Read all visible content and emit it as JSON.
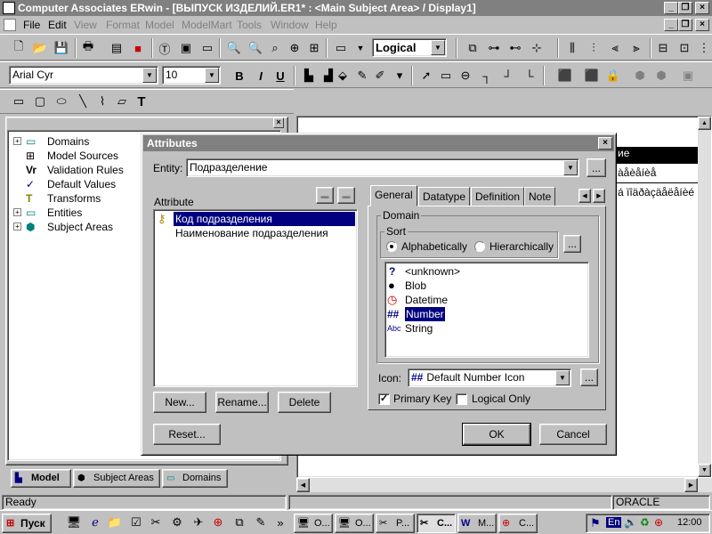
{
  "window": {
    "title": "Computer Associates ERwin - [ВЫПУСК ИЗДЕЛИЙ.ER1* : <Main Subject Area> / Display1]"
  },
  "menu": [
    {
      "label": "File",
      "enabled": true
    },
    {
      "label": "Edit",
      "enabled": true
    },
    {
      "label": "View",
      "enabled": false
    },
    {
      "label": "Format",
      "enabled": false
    },
    {
      "label": "Model",
      "enabled": false
    },
    {
      "label": "ModelMart",
      "enabled": false
    },
    {
      "label": "Tools",
      "enabled": false
    },
    {
      "label": "Window",
      "enabled": false
    },
    {
      "label": "Help",
      "enabled": false
    }
  ],
  "toolbar": {
    "view_level": "Logical",
    "font_name": "Arial Cyr",
    "font_size": "10",
    "bold": "B",
    "italic": "I",
    "underline": "U",
    "text_tool": "T"
  },
  "tree": {
    "items": [
      {
        "label": "Domains",
        "expandable": true,
        "icon": "domains-icon"
      },
      {
        "label": "Model Sources",
        "expandable": false,
        "icon": "model-sources-icon"
      },
      {
        "label": "Validation Rules",
        "expandable": false,
        "icon": "validation-rules-icon"
      },
      {
        "label": "Default Values",
        "expandable": false,
        "icon": "default-values-icon"
      },
      {
        "label": "Transforms",
        "expandable": false,
        "icon": "transforms-icon"
      },
      {
        "label": "Entities",
        "expandable": true,
        "icon": "entities-icon"
      },
      {
        "label": "Subject Areas",
        "expandable": true,
        "icon": "subject-areas-icon"
      }
    ],
    "tabs": [
      "Model",
      "Subject Areas",
      "Domains"
    ]
  },
  "canvas": {
    "snippet_1": "ие",
    "snippet_2": "àåèåíèå",
    "snippet_3": "á ïîäðàçäåëåíèé"
  },
  "dialog": {
    "title": "Attributes",
    "entity_label": "Entity:",
    "entity_value": "Подразделение",
    "attribute_label": "Attribute",
    "attributes": [
      {
        "label": "Код подразделения",
        "selected": true,
        "key": true
      },
      {
        "label": "Наименование подразделения",
        "selected": false,
        "key": false
      }
    ],
    "buttons": {
      "new": "New...",
      "rename": "Rename...",
      "delete": "Delete",
      "reset": "Reset...",
      "ok": "OK",
      "cancel": "Cancel",
      "ellipsis": "..."
    },
    "tabs": [
      "General",
      "Datatype",
      "Definition",
      "Note"
    ],
    "active_tab": "General",
    "domain_group_label": "Domain",
    "sort_group_label": "Sort",
    "sort_options": [
      "Alphabetically",
      "Hierarchically"
    ],
    "sort_selected": "Alphabetically",
    "domains": [
      {
        "label": "<unknown>",
        "icon": "question-icon",
        "selected": false
      },
      {
        "label": "Blob",
        "icon": "blob-icon",
        "selected": false
      },
      {
        "label": "Datetime",
        "icon": "clock-icon",
        "selected": false
      },
      {
        "label": "Number",
        "icon": "number-icon",
        "selected": true
      },
      {
        "label": "String",
        "icon": "string-icon",
        "selected": false
      }
    ],
    "icon_label": "Icon:",
    "icon_value": "Default Number Icon",
    "primary_key_label": "Primary Key",
    "primary_key_checked": true,
    "logical_only_label": "Logical Only",
    "logical_only_checked": false
  },
  "status": {
    "left": "Ready",
    "right": "ORACLE"
  },
  "taskbar": {
    "start": "Пуск",
    "tasks": [
      "O...",
      "O...",
      "P...",
      "C...",
      "M...",
      "C..."
    ],
    "lang": "En",
    "clock": "12:00"
  },
  "colors": {
    "title_inactive": "#808080",
    "selection": "#000080",
    "face": "#c0c0c0"
  }
}
